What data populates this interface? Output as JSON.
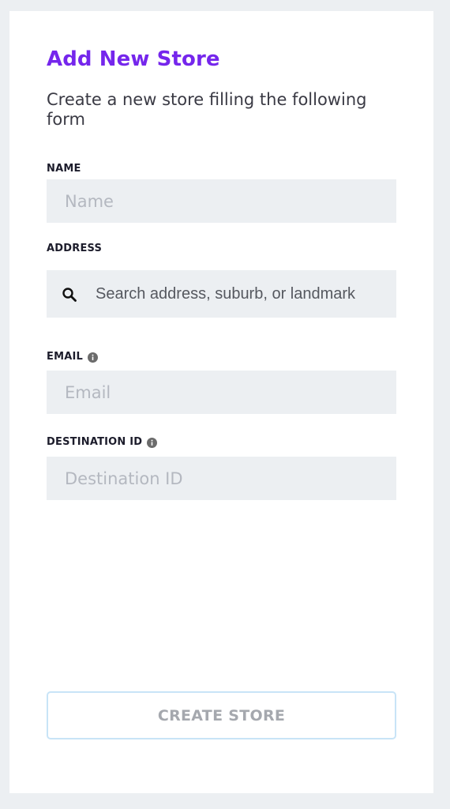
{
  "form": {
    "title": "Add New Store",
    "subtitle": "Create a new store filling the following form",
    "name": {
      "label": "NAME",
      "placeholder": "Name",
      "value": ""
    },
    "address": {
      "label": "ADDRESS",
      "placeholder": "Search address, suburb, or landmark",
      "value": "",
      "icon": "search-icon"
    },
    "email": {
      "label": "EMAIL",
      "placeholder": "Email",
      "value": "",
      "info_icon": "info-icon"
    },
    "destination_id": {
      "label": "DESTINATION ID",
      "placeholder": "Destination ID",
      "value": "",
      "info_icon": "info-icon"
    },
    "submit_label": "CREATE STORE"
  },
  "colors": {
    "accent": "#7526ec",
    "background": "#eceff2",
    "field_background": "#eceff2",
    "button_border": "#c8e4f7",
    "button_text": "#a5a8ae"
  }
}
